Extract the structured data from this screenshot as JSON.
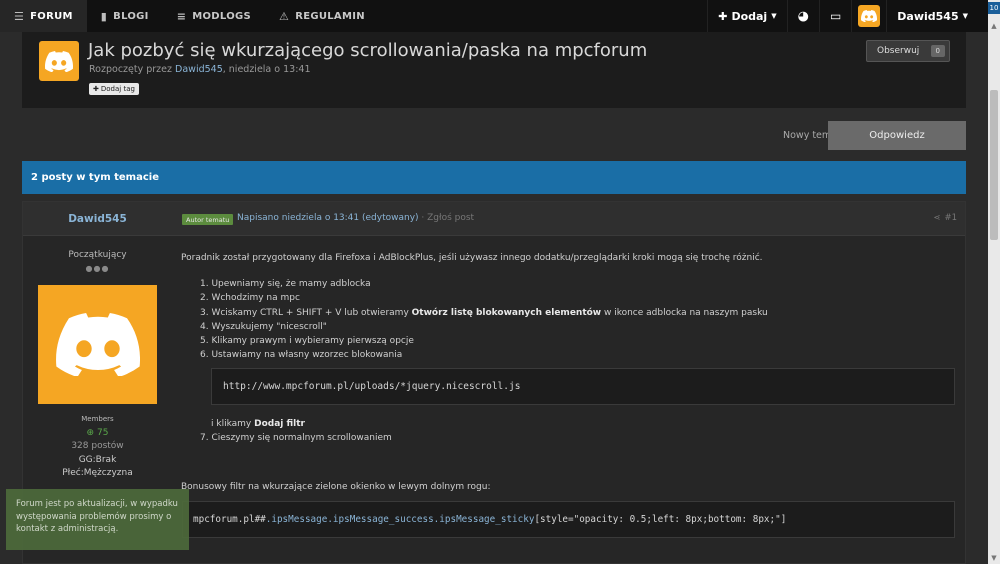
{
  "nav": {
    "items": [
      {
        "label": "FORUM",
        "icon": "menu-icon"
      },
      {
        "label": "BLOGI",
        "icon": "book-icon"
      },
      {
        "label": "MODLOGS",
        "icon": "list-icon"
      },
      {
        "label": "REGULAMIN",
        "icon": "warning-icon"
      }
    ],
    "add_label": "Dodaj",
    "user_name": "Dawid545",
    "notification_count": "10"
  },
  "thread": {
    "title": "Jak pozbyć się wkurzającego scrollowania/paska na mpcforum",
    "started_prefix": "Rozpoczęty przez",
    "author": "Dawid545",
    "date": ", niedziela o 13:41",
    "add_tag": "Dodaj tag",
    "follow_label": "Obserwuj",
    "follow_count": "0"
  },
  "actions": {
    "new_topic": "Nowy temat",
    "reply": "Odpowiedz"
  },
  "post_count_label": "2 posty w tym temacie",
  "post": {
    "author": "Dawid545",
    "author_badge": "Autor tematu",
    "date": "Napisano niedziela o 13:41 (edytowany)",
    "report": "· Zgłoś post",
    "number": "#1",
    "rank": "Początkujący",
    "group": "Members",
    "reputation": "75",
    "posts": "328 postów",
    "gg": "GG:Brak",
    "gender": "Płeć:Mężczyzna",
    "intro": "Poradnik został przygotowany dla Firefoxa i AdBlockPlus, jeśli używasz innego dodatku/przeglądarki kroki mogą się trochę różnić.",
    "steps": [
      "1. Upewniamy się, że mamy adblocka",
      "2. Wchodzimy na mpc",
      "4. Wyszukujemy \"nicescroll\"",
      "5. Klikamy prawym i wybieramy pierwszą opcje",
      "6. Ustawiamy na własny wzorzec blokowania"
    ],
    "step3_pre": "3. Wciskamy CTRL + SHIFT + V lub otwieramy ",
    "step3_bold": "Otwórz listę blokowanych elementów",
    "step3_post": " w ikonce adblocka na naszym pasku",
    "code1": "http://www.mpcforum.pl/uploads/*jquery.nicescroll.js",
    "after_pre": "i klikamy ",
    "after_bold": "Dodaj filtr",
    "step7": "7. Cieszymy się normalnym scrollowaniem",
    "bonus": "Bonusowy filtr na wkurzające zielone okienko w lewym dolnym rogu:",
    "code2_a": "mpcforum.pl##",
    "code2_b": ".ipsMessage.ipsMessage_success.ipsMessage_sticky",
    "code2_c": "[style=\"opacity: 0.5;left: 8px;bottom: 8px;\"]"
  },
  "toast": "Forum jest po aktualizacji, w wypadku występowania problemów prosimy o kontakt z administracją.",
  "colors": {
    "accent_blue": "#1a6ea6",
    "avatar_orange": "#f5a623",
    "badge_green": "#5c8c3e",
    "toast_green": "#4d6a3b"
  }
}
